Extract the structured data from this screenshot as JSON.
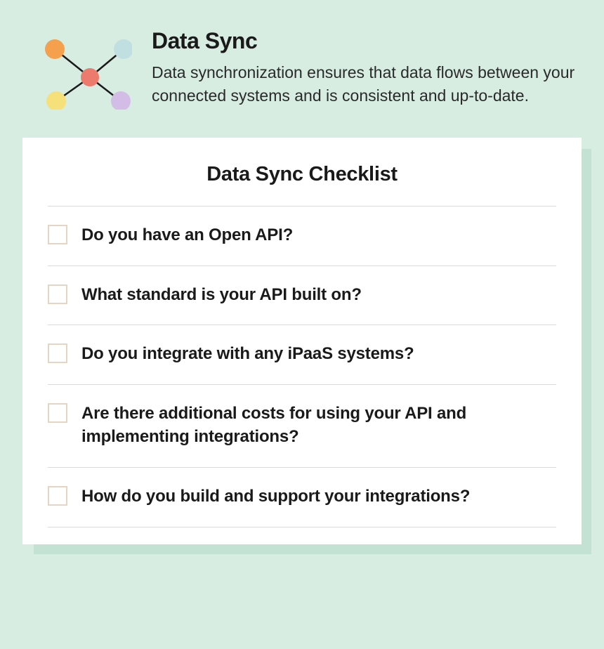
{
  "header": {
    "title": "Data Sync",
    "description": "Data synchronization ensures that data flows between your connected systems and is consistent and up-to-date."
  },
  "icon": {
    "name": "network-nodes-icon",
    "nodes": {
      "center": "#ec7a6d",
      "top_left": "#f5a04c",
      "top_right": "#c0dfe0",
      "bottom_left": "#f6e07a",
      "bottom_right": "#d3bde7"
    }
  },
  "card": {
    "title": "Data Sync Checklist",
    "items": [
      "Do you have an Open API?",
      " What standard is your API built on?",
      "Do you integrate with any iPaaS systems?",
      "Are there additional costs for using your API and implementing integrations?",
      "How do you build and support your integrations?"
    ]
  },
  "colors": {
    "page_bg": "#d7ede2",
    "card_bg": "#ffffff",
    "shadow": "#c3e2d4",
    "text": "#1a1a1a",
    "divider": "#d9d9d9",
    "checkbox_border": "#e4d5c4"
  }
}
